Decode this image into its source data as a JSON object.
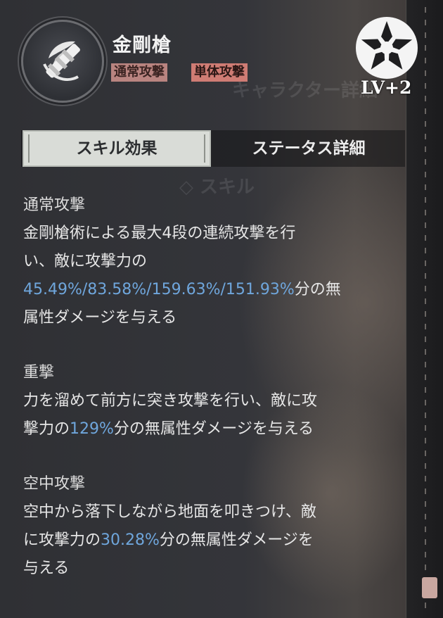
{
  "skill": {
    "name": "金剛槍",
    "tags": [
      "通常攻撃",
      "単体攻撃"
    ],
    "level": "LV+2",
    "icon": "spear-emblem-icon",
    "crest_icon": "flower-crest-icon"
  },
  "tabs": [
    {
      "label": "スキル効果",
      "active": true
    },
    {
      "label": "ステータス詳細",
      "active": false
    }
  ],
  "background_text": [
    "キャラクター詳細",
    "◇ スキル"
  ],
  "sections": [
    {
      "title": "通常攻撃",
      "lines": [
        "金剛槍術による最大4段の連続攻撃を行",
        "い、敵に攻撃力の",
        {
          "hl": "45.49%/83.58%/159.63%/151.93%",
          "after": "分の無"
        },
        "属性ダメージを与える"
      ]
    },
    {
      "title": "重撃",
      "line1": "力を溜めて前方に突き攻撃を行い、敵に攻",
      "line2_before": "撃力の",
      "line2_hl": "129%",
      "line2_after": "分の無属性ダメージを与える"
    },
    {
      "title": "空中攻撃",
      "line1": "空中から落下しながら地面を叩きつけ、敵",
      "line2_before": "に攻撃力の",
      "line2_hl": "30.28%",
      "line2_after": "分の無属性ダメージを",
      "line3": "与える"
    }
  ],
  "colors": {
    "highlight": "#6fa6dc",
    "tag_normal": "#b98480",
    "tag_single": "#cf7c74",
    "tab_active_bg": "#d9dcd7"
  }
}
